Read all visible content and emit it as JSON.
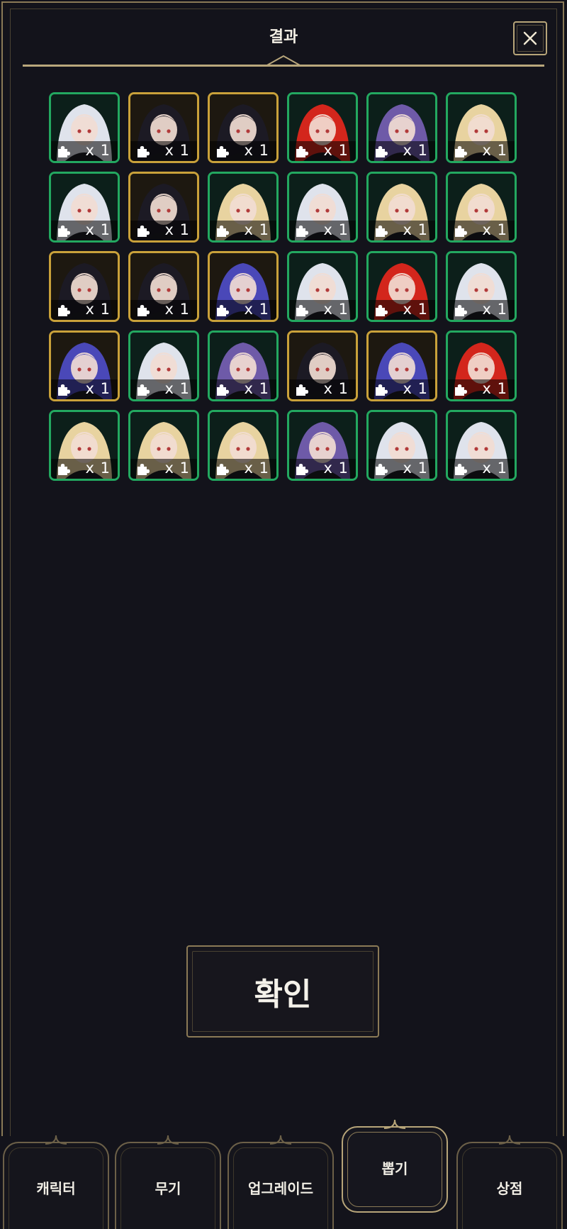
{
  "header": {
    "title": "결과"
  },
  "results": {
    "items": [
      {
        "hair": "#dfe3ec",
        "frame": "#23a860",
        "qty": "x 1"
      },
      {
        "hair": "#1c1a24",
        "frame": "#c9a13a",
        "qty": "x 1"
      },
      {
        "hair": "#1c1a24",
        "frame": "#c9a13a",
        "qty": "x 1"
      },
      {
        "hair": "#d3261c",
        "frame": "#23a860",
        "qty": "x 1"
      },
      {
        "hair": "#6e5aa8",
        "frame": "#23a860",
        "qty": "x 1"
      },
      {
        "hair": "#e8d3a0",
        "frame": "#23a860",
        "qty": "x 1"
      },
      {
        "hair": "#dfe3ec",
        "frame": "#23a860",
        "qty": "x 1"
      },
      {
        "hair": "#1c1a24",
        "frame": "#c9a13a",
        "qty": "x 1"
      },
      {
        "hair": "#e8d3a0",
        "frame": "#23a860",
        "qty": "x 1"
      },
      {
        "hair": "#dfe3ec",
        "frame": "#23a860",
        "qty": "x 1"
      },
      {
        "hair": "#e8d3a0",
        "frame": "#23a860",
        "qty": "x 1"
      },
      {
        "hair": "#e8d3a0",
        "frame": "#23a860",
        "qty": "x 1"
      },
      {
        "hair": "#1c1a24",
        "frame": "#c9a13a",
        "qty": "x 1"
      },
      {
        "hair": "#1c1a24",
        "frame": "#c9a13a",
        "qty": "x 1"
      },
      {
        "hair": "#4a48b8",
        "frame": "#c9a13a",
        "qty": "x 1"
      },
      {
        "hair": "#dfe3ec",
        "frame": "#23a860",
        "qty": "x 1"
      },
      {
        "hair": "#d3261c",
        "frame": "#23a860",
        "qty": "x 1"
      },
      {
        "hair": "#dfe3ec",
        "frame": "#23a860",
        "qty": "x 1"
      },
      {
        "hair": "#4a48b8",
        "frame": "#c9a13a",
        "qty": "x 1"
      },
      {
        "hair": "#dfe3ec",
        "frame": "#23a860",
        "qty": "x 1"
      },
      {
        "hair": "#6e5aa8",
        "frame": "#23a860",
        "qty": "x 1"
      },
      {
        "hair": "#1c1a24",
        "frame": "#c9a13a",
        "qty": "x 1"
      },
      {
        "hair": "#4a48b8",
        "frame": "#c9a13a",
        "qty": "x 1"
      },
      {
        "hair": "#d3261c",
        "frame": "#23a860",
        "qty": "x 1"
      },
      {
        "hair": "#e8d3a0",
        "frame": "#23a860",
        "qty": "x 1"
      },
      {
        "hair": "#e8d3a0",
        "frame": "#23a860",
        "qty": "x 1"
      },
      {
        "hair": "#e8d3a0",
        "frame": "#23a860",
        "qty": "x 1"
      },
      {
        "hair": "#6e5aa8",
        "frame": "#23a860",
        "qty": "x 1"
      },
      {
        "hair": "#dfe3ec",
        "frame": "#23a860",
        "qty": "x 1"
      },
      {
        "hair": "#dfe3ec",
        "frame": "#23a860",
        "qty": "x 1"
      }
    ]
  },
  "confirm_button": {
    "label": "확인"
  },
  "nav": {
    "tabs": [
      {
        "label": "캐릭터"
      },
      {
        "label": "무기"
      },
      {
        "label": "업그레이드"
      },
      {
        "label": "뽑기"
      },
      {
        "label": "상점"
      }
    ]
  },
  "colors": {
    "accent_gold": "#b7a579",
    "rare_frame_green": "#23a860",
    "epic_frame_gold": "#c9a13a",
    "panel_bg": "#13131b"
  }
}
